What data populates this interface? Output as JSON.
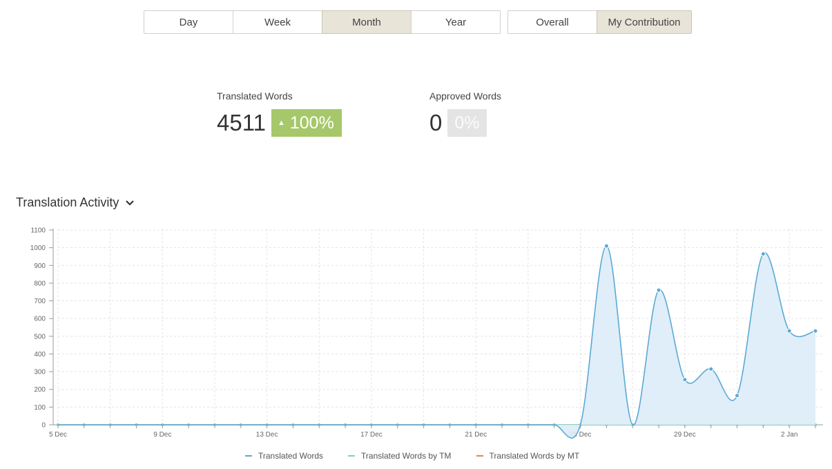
{
  "period_tabs": [
    {
      "label": "Day",
      "active": false
    },
    {
      "label": "Week",
      "active": false
    },
    {
      "label": "Month",
      "active": true
    },
    {
      "label": "Year",
      "active": false
    }
  ],
  "scope_tabs": [
    {
      "label": "Overall",
      "active": false
    },
    {
      "label": "My Contribution",
      "active": true
    }
  ],
  "stats": {
    "translated": {
      "label": "Translated Words",
      "value": "4511",
      "change": "100%",
      "trend": "up"
    },
    "approved": {
      "label": "Approved Words",
      "value": "0",
      "change": "0%"
    }
  },
  "section": {
    "title": "Translation Activity"
  },
  "colors": {
    "tw": "#5ba8d6",
    "tm": "#7ecfc0",
    "mt": "#e8814f",
    "fill": "#dbecf7"
  },
  "chart_data": {
    "type": "area",
    "x": [
      "5 Dec",
      "6 Dec",
      "7 Dec",
      "8 Dec",
      "9 Dec",
      "10 Dec",
      "11 Dec",
      "12 Dec",
      "13 Dec",
      "14 Dec",
      "15 Dec",
      "16 Dec",
      "17 Dec",
      "18 Dec",
      "19 Dec",
      "20 Dec",
      "21 Dec",
      "22 Dec",
      "23 Dec",
      "24 Dec",
      "25 Dec",
      "26 Dec",
      "27 Dec",
      "28 Dec",
      "29 Dec",
      "30 Dec",
      "31 Dec",
      "1 Jan",
      "2 Jan",
      "3 Jan"
    ],
    "x_tick_labels": [
      "5 Dec",
      "9 Dec",
      "13 Dec",
      "17 Dec",
      "21 Dec",
      "25 Dec",
      "29 Dec",
      "2 Jan"
    ],
    "series": [
      {
        "name": "Translated Words",
        "values": [
          0,
          0,
          0,
          0,
          0,
          0,
          0,
          0,
          0,
          0,
          0,
          0,
          0,
          0,
          0,
          0,
          0,
          0,
          0,
          0,
          0,
          1010,
          0,
          760,
          255,
          315,
          165,
          965,
          530,
          530
        ]
      },
      {
        "name": "Translated Words by TM",
        "values": [
          0,
          0,
          0,
          0,
          0,
          0,
          0,
          0,
          0,
          0,
          0,
          0,
          0,
          0,
          0,
          0,
          0,
          0,
          0,
          0,
          0,
          0,
          0,
          0,
          0,
          0,
          0,
          0,
          0,
          0
        ]
      },
      {
        "name": "Translated Words by MT",
        "values": [
          0,
          0,
          0,
          0,
          0,
          0,
          0,
          0,
          0,
          0,
          0,
          0,
          0,
          0,
          0,
          0,
          0,
          0,
          0,
          0,
          0,
          0,
          0,
          0,
          0,
          0,
          0,
          0,
          0,
          0
        ]
      }
    ],
    "y_ticks": [
      0,
      100,
      200,
      300,
      400,
      500,
      600,
      700,
      800,
      900,
      1000,
      1100
    ],
    "ylim": [
      0,
      1100
    ],
    "grid": true,
    "legend_position": "bottom"
  }
}
